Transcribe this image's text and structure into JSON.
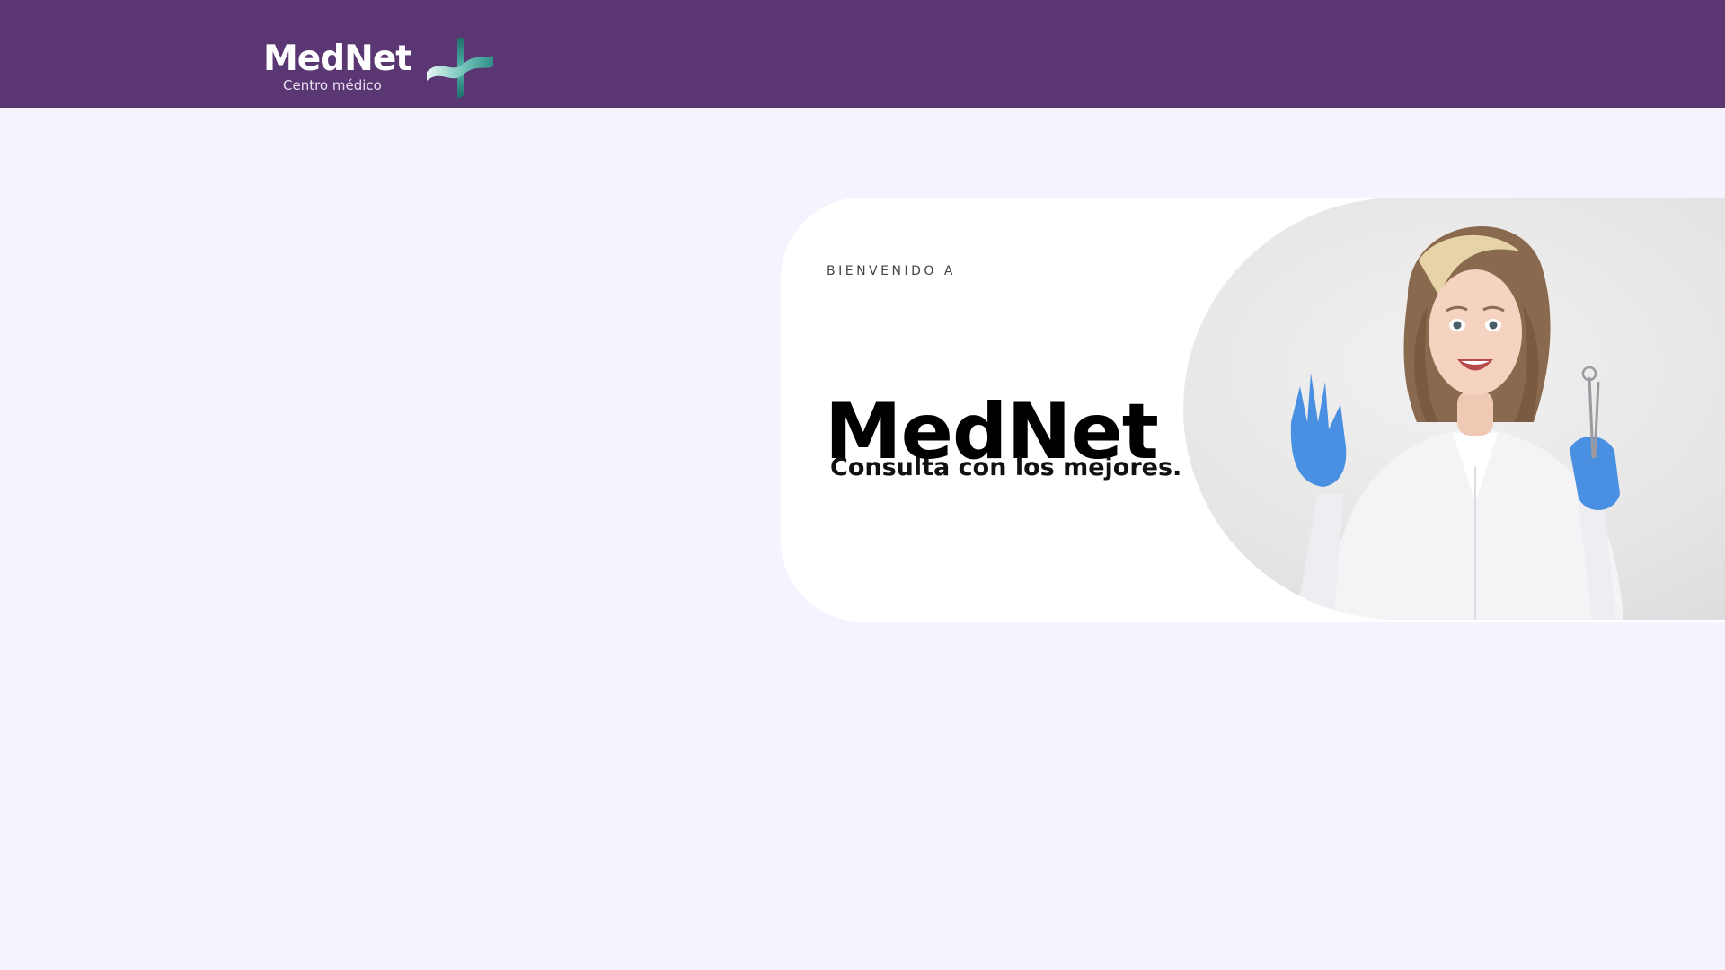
{
  "header": {
    "logo": {
      "name": "MedNet",
      "tagline": "Centro médico",
      "mark_icon": "medical-cross-icon"
    }
  },
  "hero": {
    "eyebrow": "BIENVENIDO A",
    "title": "MedNet",
    "subtitle": "Consulta con los mejores.",
    "image": "smiling-dentist-photo"
  },
  "colors": {
    "header_bg": "#5a3772",
    "page_bg": "#f6f3fe",
    "card_bg": "#ffffff",
    "logo_teal": "#2f8f88",
    "glove_blue": "#4a90e2"
  }
}
